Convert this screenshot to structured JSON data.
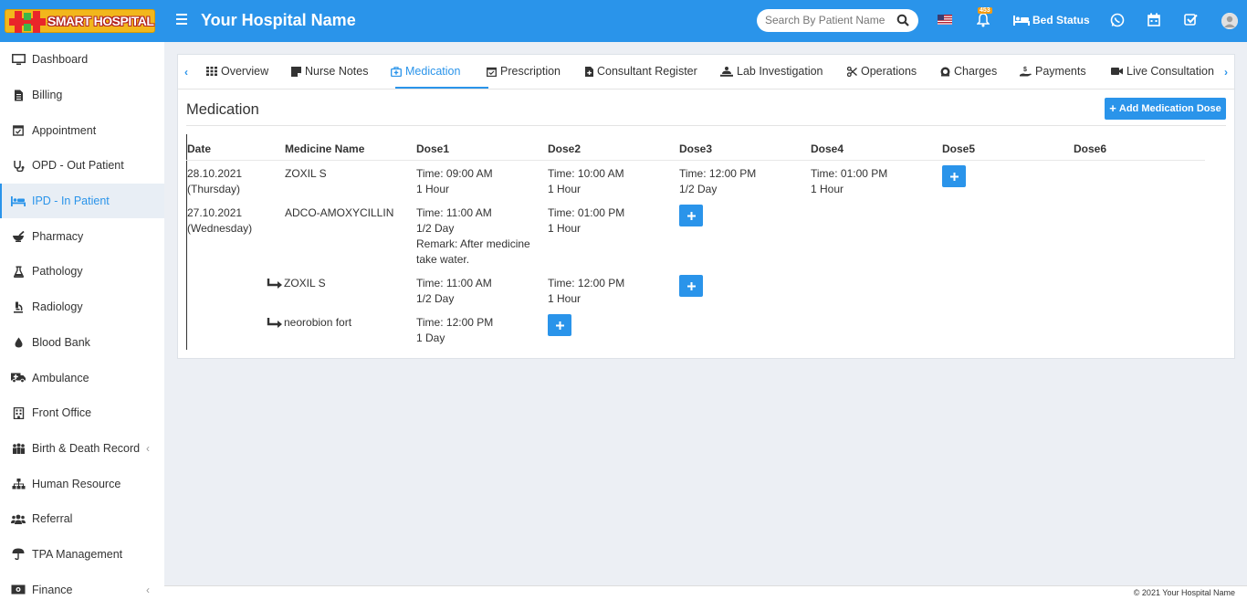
{
  "header": {
    "logo_text": "SMART HOSPITAL",
    "hospital_name": "Your Hospital Name",
    "search_placeholder": "Search By Patient Name",
    "notification_count": "453",
    "bed_status_label": "Bed Status",
    "color": "#2a94ea"
  },
  "sidebar": {
    "items": [
      {
        "label": "Dashboard",
        "icon": "monitor-icon"
      },
      {
        "label": "Billing",
        "icon": "file-icon"
      },
      {
        "label": "Appointment",
        "icon": "calendar-check-icon"
      },
      {
        "label": "OPD - Out Patient",
        "icon": "stethoscope-icon"
      },
      {
        "label": "IPD - In Patient",
        "icon": "bed-icon",
        "active": true
      },
      {
        "label": "Pharmacy",
        "icon": "mortar-pestle-icon"
      },
      {
        "label": "Pathology",
        "icon": "flask-icon"
      },
      {
        "label": "Radiology",
        "icon": "microscope-icon"
      },
      {
        "label": "Blood Bank",
        "icon": "tint-icon"
      },
      {
        "label": "Ambulance",
        "icon": "ambulance-icon"
      },
      {
        "label": "Front Office",
        "icon": "building-icon"
      },
      {
        "label": "Birth & Death Record",
        "icon": "users-icon"
      },
      {
        "label": "Human Resource",
        "icon": "sitemap-icon"
      },
      {
        "label": "Referral",
        "icon": "people-icon"
      },
      {
        "label": "TPA Management",
        "icon": "umbrella-icon"
      },
      {
        "label": "Finance",
        "icon": "money-icon"
      }
    ]
  },
  "tabs": [
    {
      "label": "Overview"
    },
    {
      "label": "Nurse Notes"
    },
    {
      "label": "Medication",
      "active": true
    },
    {
      "label": "Prescription"
    },
    {
      "label": "Consultant Register"
    },
    {
      "label": "Lab Investigation"
    },
    {
      "label": "Operations"
    },
    {
      "label": "Charges"
    },
    {
      "label": "Payments"
    },
    {
      "label": "Live Consultation"
    }
  ],
  "medication": {
    "title": "Medication",
    "add_button": "Add Medication Dose",
    "columns": [
      "Date",
      "Medicine Name",
      "Dose1",
      "Dose2",
      "Dose3",
      "Dose4",
      "Dose5",
      "Dose6"
    ],
    "rows": [
      {
        "date": "28.10.2021",
        "day": "(Thursday)",
        "medicine": "ZOXIL S",
        "doses": [
          {
            "time": "Time: 09:00 AM",
            "qty": "1 Hour"
          },
          {
            "time": "Time: 10:00 AM",
            "qty": "1 Hour"
          },
          {
            "time": "Time: 12:00 PM",
            "qty": "1/2 Day"
          },
          {
            "time": "Time: 01:00 PM",
            "qty": "1 Hour"
          }
        ]
      },
      {
        "date": "27.10.2021",
        "day": "(Wednesday)",
        "medicine": "ADCO-AMOXYCILLIN",
        "doses": [
          {
            "time": "Time: 11:00 AM",
            "qty": "1/2 Day",
            "remark1": "Remark: After medicine",
            "remark2": "take water."
          },
          {
            "time": "Time: 01:00 PM",
            "qty": "1 Hour"
          }
        ]
      },
      {
        "date": "",
        "day": "",
        "medicine": "ZOXIL S",
        "doses": [
          {
            "time": "Time: 11:00 AM",
            "qty": "1/2 Day"
          },
          {
            "time": "Time: 12:00 PM",
            "qty": "1 Hour"
          }
        ]
      },
      {
        "date": "",
        "day": "",
        "medicine": "neorobion fort",
        "doses": [
          {
            "time": "Time: 12:00 PM",
            "qty": "1 Day"
          }
        ]
      }
    ]
  },
  "footer": {
    "text": "© 2021 Your Hospital Name"
  }
}
